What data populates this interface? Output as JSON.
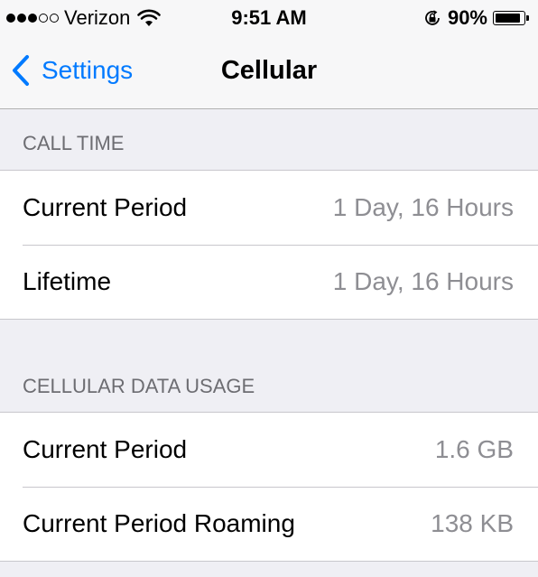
{
  "status_bar": {
    "signal": {
      "filled": 3,
      "total": 5
    },
    "carrier": "Verizon",
    "time": "9:51 AM",
    "battery_percent": "90%",
    "battery_level": 0.9
  },
  "nav": {
    "back_label": "Settings",
    "title": "Cellular"
  },
  "sections": {
    "call_time": {
      "header": "CALL TIME",
      "rows": [
        {
          "label": "Current Period",
          "value": "1 Day, 16 Hours"
        },
        {
          "label": "Lifetime",
          "value": "1 Day, 16 Hours"
        }
      ]
    },
    "data_usage": {
      "header": "CELLULAR DATA USAGE",
      "rows": [
        {
          "label": "Current Period",
          "value": "1.6 GB"
        },
        {
          "label": "Current Period Roaming",
          "value": "138 KB"
        }
      ]
    }
  },
  "colors": {
    "accent": "#007aff",
    "background": "#efeff4",
    "secondary_text": "#8e8e93"
  },
  "icons": [
    "wifi-icon",
    "rotation-lock-icon",
    "battery-icon",
    "chevron-left-icon"
  ]
}
